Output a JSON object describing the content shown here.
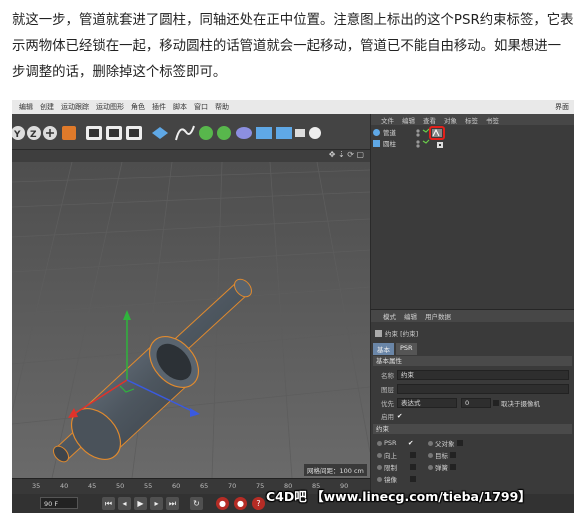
{
  "article": {
    "paragraph": "就这一步，管道就套进了圆柱，同轴还处在正中位置。注意图上标出的这个PSR约束标签，它表示两物体已经锁在一起，移动圆柱的话管道就会一起移动，管道已不能自由移动。如果想进一步调整的话，删除掉这个标签即可。"
  },
  "menubar": {
    "items": [
      "编辑",
      "创建",
      "运动跟踪",
      "运动图形",
      "角色",
      "插件",
      "脚本",
      "窗口",
      "帮助"
    ],
    "layout_label": "界面"
  },
  "object_manager": {
    "menu": [
      "文件",
      "编辑",
      "查看",
      "对象",
      "标签",
      "书签"
    ],
    "objects": [
      {
        "name": "管道",
        "icon": "pipe-icon"
      },
      {
        "name": "圆柱",
        "icon": "cylinder-icon"
      }
    ]
  },
  "attributes": {
    "menu": [
      "模式",
      "编辑",
      "用户数据"
    ],
    "title": "约束 [约束]",
    "tabs": [
      "基本",
      "PSR"
    ],
    "basic_section": "基本属性",
    "name_label": "名称",
    "name_value": "约束",
    "layer_label": "图层",
    "priority_label": "优先",
    "priority_value": "表达式",
    "priority_number": "0",
    "camera_label": "取决于摄像机",
    "enable_label": "启用",
    "constraint_section": "约束",
    "options": [
      [
        "PSR",
        "父对象"
      ],
      [
        "向上",
        "目标"
      ],
      [
        "限制",
        "弹簧"
      ],
      [
        "镜像"
      ]
    ]
  },
  "viewport": {
    "grid_label": "网格间距：100 cm"
  },
  "timeline": {
    "ticks": [
      "35",
      "40",
      "45",
      "50",
      "55",
      "60",
      "65",
      "70",
      "75",
      "80",
      "85",
      "90"
    ],
    "frame_value": "90 F"
  },
  "watermark": "C4D吧 【www.linecg.com/tieba/1799】"
}
